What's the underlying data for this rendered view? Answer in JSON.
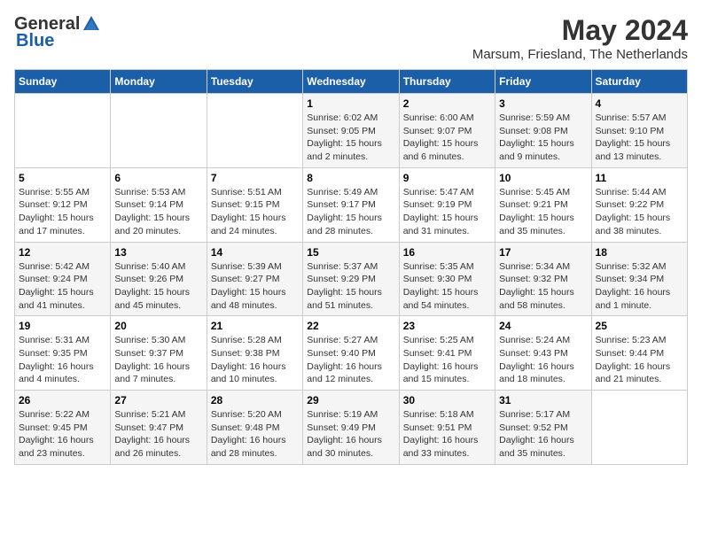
{
  "logo": {
    "general": "General",
    "blue": "Blue"
  },
  "title": {
    "month_year": "May 2024",
    "location": "Marsum, Friesland, The Netherlands"
  },
  "headers": [
    "Sunday",
    "Monday",
    "Tuesday",
    "Wednesday",
    "Thursday",
    "Friday",
    "Saturday"
  ],
  "weeks": [
    [
      {
        "day": "",
        "info": ""
      },
      {
        "day": "",
        "info": ""
      },
      {
        "day": "",
        "info": ""
      },
      {
        "day": "1",
        "info": "Sunrise: 6:02 AM\nSunset: 9:05 PM\nDaylight: 15 hours\nand 2 minutes."
      },
      {
        "day": "2",
        "info": "Sunrise: 6:00 AM\nSunset: 9:07 PM\nDaylight: 15 hours\nand 6 minutes."
      },
      {
        "day": "3",
        "info": "Sunrise: 5:59 AM\nSunset: 9:08 PM\nDaylight: 15 hours\nand 9 minutes."
      },
      {
        "day": "4",
        "info": "Sunrise: 5:57 AM\nSunset: 9:10 PM\nDaylight: 15 hours\nand 13 minutes."
      }
    ],
    [
      {
        "day": "5",
        "info": "Sunrise: 5:55 AM\nSunset: 9:12 PM\nDaylight: 15 hours\nand 17 minutes."
      },
      {
        "day": "6",
        "info": "Sunrise: 5:53 AM\nSunset: 9:14 PM\nDaylight: 15 hours\nand 20 minutes."
      },
      {
        "day": "7",
        "info": "Sunrise: 5:51 AM\nSunset: 9:15 PM\nDaylight: 15 hours\nand 24 minutes."
      },
      {
        "day": "8",
        "info": "Sunrise: 5:49 AM\nSunset: 9:17 PM\nDaylight: 15 hours\nand 28 minutes."
      },
      {
        "day": "9",
        "info": "Sunrise: 5:47 AM\nSunset: 9:19 PM\nDaylight: 15 hours\nand 31 minutes."
      },
      {
        "day": "10",
        "info": "Sunrise: 5:45 AM\nSunset: 9:21 PM\nDaylight: 15 hours\nand 35 minutes."
      },
      {
        "day": "11",
        "info": "Sunrise: 5:44 AM\nSunset: 9:22 PM\nDaylight: 15 hours\nand 38 minutes."
      }
    ],
    [
      {
        "day": "12",
        "info": "Sunrise: 5:42 AM\nSunset: 9:24 PM\nDaylight: 15 hours\nand 41 minutes."
      },
      {
        "day": "13",
        "info": "Sunrise: 5:40 AM\nSunset: 9:26 PM\nDaylight: 15 hours\nand 45 minutes."
      },
      {
        "day": "14",
        "info": "Sunrise: 5:39 AM\nSunset: 9:27 PM\nDaylight: 15 hours\nand 48 minutes."
      },
      {
        "day": "15",
        "info": "Sunrise: 5:37 AM\nSunset: 9:29 PM\nDaylight: 15 hours\nand 51 minutes."
      },
      {
        "day": "16",
        "info": "Sunrise: 5:35 AM\nSunset: 9:30 PM\nDaylight: 15 hours\nand 54 minutes."
      },
      {
        "day": "17",
        "info": "Sunrise: 5:34 AM\nSunset: 9:32 PM\nDaylight: 15 hours\nand 58 minutes."
      },
      {
        "day": "18",
        "info": "Sunrise: 5:32 AM\nSunset: 9:34 PM\nDaylight: 16 hours\nand 1 minute."
      }
    ],
    [
      {
        "day": "19",
        "info": "Sunrise: 5:31 AM\nSunset: 9:35 PM\nDaylight: 16 hours\nand 4 minutes."
      },
      {
        "day": "20",
        "info": "Sunrise: 5:30 AM\nSunset: 9:37 PM\nDaylight: 16 hours\nand 7 minutes."
      },
      {
        "day": "21",
        "info": "Sunrise: 5:28 AM\nSunset: 9:38 PM\nDaylight: 16 hours\nand 10 minutes."
      },
      {
        "day": "22",
        "info": "Sunrise: 5:27 AM\nSunset: 9:40 PM\nDaylight: 16 hours\nand 12 minutes."
      },
      {
        "day": "23",
        "info": "Sunrise: 5:25 AM\nSunset: 9:41 PM\nDaylight: 16 hours\nand 15 minutes."
      },
      {
        "day": "24",
        "info": "Sunrise: 5:24 AM\nSunset: 9:43 PM\nDaylight: 16 hours\nand 18 minutes."
      },
      {
        "day": "25",
        "info": "Sunrise: 5:23 AM\nSunset: 9:44 PM\nDaylight: 16 hours\nand 21 minutes."
      }
    ],
    [
      {
        "day": "26",
        "info": "Sunrise: 5:22 AM\nSunset: 9:45 PM\nDaylight: 16 hours\nand 23 minutes."
      },
      {
        "day": "27",
        "info": "Sunrise: 5:21 AM\nSunset: 9:47 PM\nDaylight: 16 hours\nand 26 minutes."
      },
      {
        "day": "28",
        "info": "Sunrise: 5:20 AM\nSunset: 9:48 PM\nDaylight: 16 hours\nand 28 minutes."
      },
      {
        "day": "29",
        "info": "Sunrise: 5:19 AM\nSunset: 9:49 PM\nDaylight: 16 hours\nand 30 minutes."
      },
      {
        "day": "30",
        "info": "Sunrise: 5:18 AM\nSunset: 9:51 PM\nDaylight: 16 hours\nand 33 minutes."
      },
      {
        "day": "31",
        "info": "Sunrise: 5:17 AM\nSunset: 9:52 PM\nDaylight: 16 hours\nand 35 minutes."
      },
      {
        "day": "",
        "info": ""
      }
    ]
  ]
}
